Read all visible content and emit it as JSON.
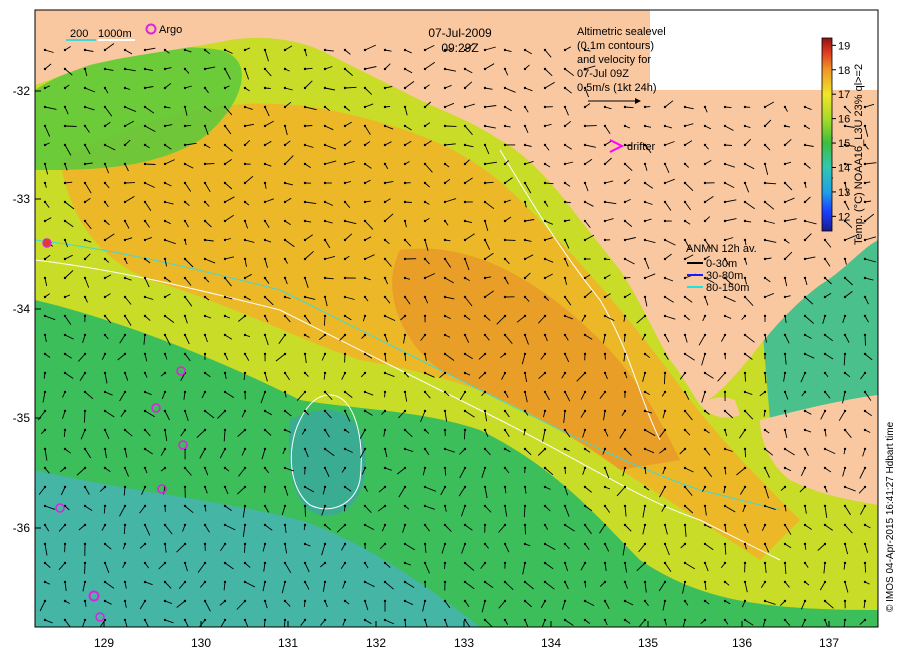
{
  "header": {
    "date": "07-Jul-2009",
    "time": "09:29Z"
  },
  "top_legend": {
    "contour_labels": [
      "200",
      "1000m"
    ],
    "argo_label": "Argo"
  },
  "altimetry_note": {
    "lines": [
      "Altimetric sealevel",
      "(0.1m contours)",
      "and velocity for",
      "07-Jul 09Z",
      "0.5m/s (1kt 24h)"
    ]
  },
  "drifter_label": "drifter",
  "anmn_legend": {
    "title": "ANMN 12h av.",
    "items": [
      {
        "label": "0-30m",
        "color": "#000000"
      },
      {
        "label": "30-80m",
        "color": "#1a1aff"
      },
      {
        "label": "80-150m",
        "color": "#20e0e0"
      }
    ]
  },
  "colorbar": {
    "title": "Temp. (°C) NOAA16_L3U 23% ql>=2",
    "ticks": [
      "12",
      "13",
      "14",
      "15",
      "16",
      "17",
      "18",
      "19"
    ],
    "min": 11.4,
    "max": 19.3,
    "stops": [
      {
        "v": 11.4,
        "color": "#1a1a8c"
      },
      {
        "v": 12.2,
        "color": "#1a40ff"
      },
      {
        "v": 13.0,
        "color": "#20a0e8"
      },
      {
        "v": 14.0,
        "color": "#30c8b4"
      },
      {
        "v": 15.0,
        "color": "#3cbe3c"
      },
      {
        "v": 16.0,
        "color": "#a8dc28"
      },
      {
        "v": 17.0,
        "color": "#f0e628"
      },
      {
        "v": 18.0,
        "color": "#f09628"
      },
      {
        "v": 18.7,
        "color": "#e03c20"
      },
      {
        "v": 19.3,
        "color": "#8c1414"
      }
    ]
  },
  "axes": {
    "lat_ticks": [
      "-32",
      "-33",
      "-34",
      "-35",
      "-36"
    ],
    "lon_ticks": [
      "129",
      "130",
      "131",
      "132",
      "133",
      "134",
      "135",
      "136",
      "137"
    ]
  },
  "credit": "© IMOS 04-Apr-2015 16:41:27 Hdbart time",
  "colors": {
    "land": "#fac8a0",
    "sea_warm": "#f0b428",
    "sea_mid": "#c8dc28",
    "sea_cool": "#3cbe5a",
    "sea_cold": "#46b4aa",
    "argo": "#e020e0",
    "drifter": "#ff00ff"
  }
}
